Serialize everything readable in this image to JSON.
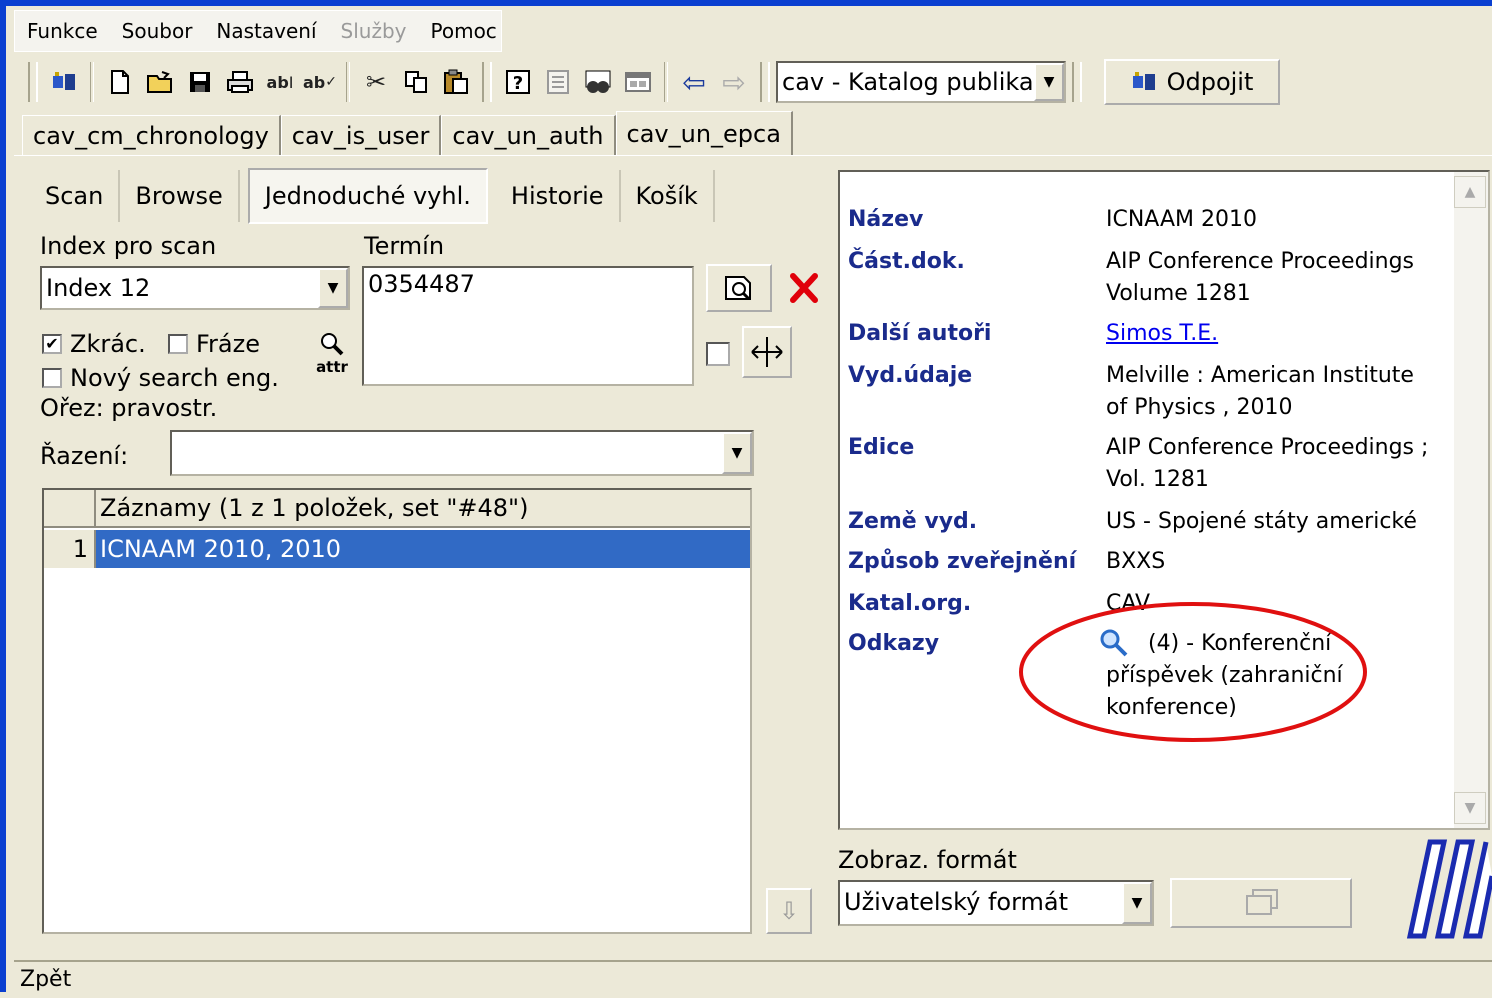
{
  "menu": {
    "items": [
      {
        "label": "Funkce",
        "disabled": false
      },
      {
        "label": "Soubor",
        "disabled": false
      },
      {
        "label": "Nastavení",
        "disabled": false
      },
      {
        "label": "Služby",
        "disabled": true
      },
      {
        "label": "Pomoc",
        "disabled": false
      }
    ]
  },
  "toolbar": {
    "catalog_select": "cav - Katalog publika",
    "disconnect_label": "Odpojit"
  },
  "tabs": [
    "cav_cm_chronology",
    "cav_is_user",
    "cav_un_auth",
    "cav_un_epca"
  ],
  "subtabs": [
    "Scan",
    "Browse",
    "Jednoduché vyhl.",
    "Historie",
    "Košík"
  ],
  "search": {
    "index_label": "Index pro scan",
    "index_value": "Index 12",
    "term_label": "Termín",
    "term_value": "0354487",
    "zkrac_label": "Zkrác.",
    "zkrac_checked": true,
    "fraze_label": "Fráze",
    "fraze_checked": false,
    "novy_label": "Nový search eng.",
    "novy_checked": false,
    "attr_label": "attr",
    "orez_label": "Ořez: pravostr.",
    "razeni_label": "Řazení:",
    "razeni_value": ""
  },
  "results": {
    "header": "Záznamy (1 z 1 položek, set \"#48\")",
    "rows": [
      {
        "num": "1",
        "text": "ICNAAM 2010, 2010"
      }
    ]
  },
  "detail": {
    "fields": [
      {
        "label": "Název",
        "lines": [
          "ICNAAM 2010"
        ]
      },
      {
        "label": "Část.dok.",
        "lines": [
          "AIP Conference Proceedings",
          "Volume 1281"
        ]
      },
      {
        "label": "Další autoři",
        "lines": [
          "Simos T.E."
        ],
        "link": true
      },
      {
        "label": "Vyd.údaje",
        "lines": [
          "Melville : American Institute",
          "of Physics , 2010"
        ]
      },
      {
        "label": "Edice",
        "lines": [
          "AIP Conference Proceedings ;",
          "Vol. 1281"
        ]
      },
      {
        "label": "Země vyd.",
        "lines": [
          "US - Spojené státy americké"
        ]
      },
      {
        "label": "Způsob zveřejnění",
        "lines": [
          "BXXS"
        ]
      },
      {
        "label": "Katal.org.",
        "lines": [
          "CAV"
        ]
      },
      {
        "label": "Odkazy",
        "lines": [
          "(4) - Konferenční",
          "příspěvek (zahraniční",
          "konference)"
        ]
      }
    ]
  },
  "format": {
    "label": "Zobraz. formát",
    "value": "Uživatelský formát"
  },
  "status": "Zpět",
  "colors": {
    "highlight_circle": "#e01010",
    "selection": "#316ac5",
    "label_blue": "#1a2b8c"
  }
}
